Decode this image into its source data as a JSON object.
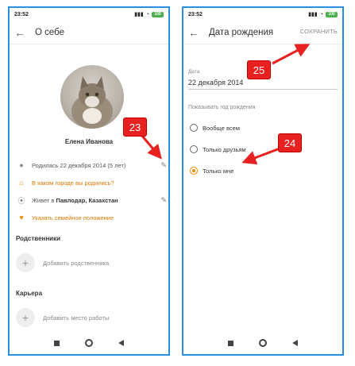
{
  "left": {
    "status": {
      "time": "23:52",
      "battery": "100"
    },
    "title": "О себе",
    "name": "Елена Иванова",
    "rows": [
      {
        "text": "Родилась 22 декабря 2014 (5 лет)"
      },
      {
        "text": "В каком городе вы родились?"
      },
      {
        "prefix": "Живет в",
        "bold": "Павлодар, Казахстан"
      },
      {
        "text": "Указать семейное положение"
      }
    ],
    "sections": {
      "relatives_title": "Родственники",
      "add_relative": "Добавить родственника",
      "career_title": "Карьера",
      "add_job": "Добавить место работы"
    }
  },
  "right": {
    "status": {
      "time": "23:52",
      "battery": "100"
    },
    "title": "Дата рождения",
    "save": "СОХРАНИТЬ",
    "date_label": "Дата",
    "date_value": "22 декабря 2014",
    "show_year_label": "Показывать год рождения",
    "options": [
      {
        "label": "Вообще всем",
        "selected": false
      },
      {
        "label": "Только друзьям",
        "selected": false
      },
      {
        "label": "Только мне",
        "selected": true
      }
    ]
  },
  "annotations": {
    "step23": "23",
    "step24": "24",
    "step25": "25"
  },
  "colors": {
    "accent": "#f08a00",
    "frame": "#2a8ee0",
    "badge": "#e8201f"
  }
}
